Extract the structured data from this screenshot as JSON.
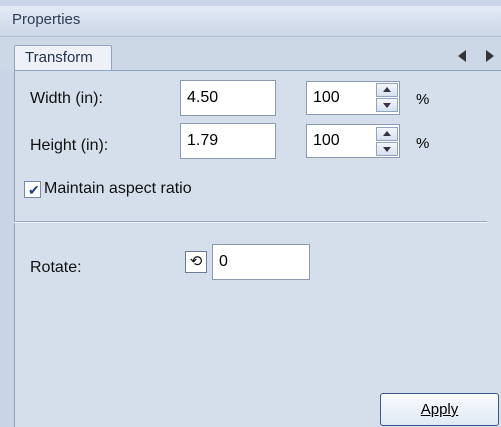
{
  "panel": {
    "title": "Properties"
  },
  "tabs": [
    {
      "label": "Transform"
    }
  ],
  "transform": {
    "width": {
      "label": "Width (in):",
      "value": "4.50",
      "percent": "100",
      "percent_sign": "%"
    },
    "height": {
      "label": "Height (in):",
      "value": "1.79",
      "percent": "100",
      "percent_sign": "%"
    },
    "maintain_aspect": {
      "label": "Maintain aspect ratio",
      "checked": true
    },
    "rotate": {
      "label": "Rotate:",
      "value": "0"
    }
  },
  "actions": {
    "apply_label": "Apply"
  },
  "icons": {
    "tab_prev": "triangle-left-icon",
    "tab_next": "triangle-right-icon",
    "rotate": "rotate-ccw-icon",
    "check": "checkmark-icon"
  }
}
